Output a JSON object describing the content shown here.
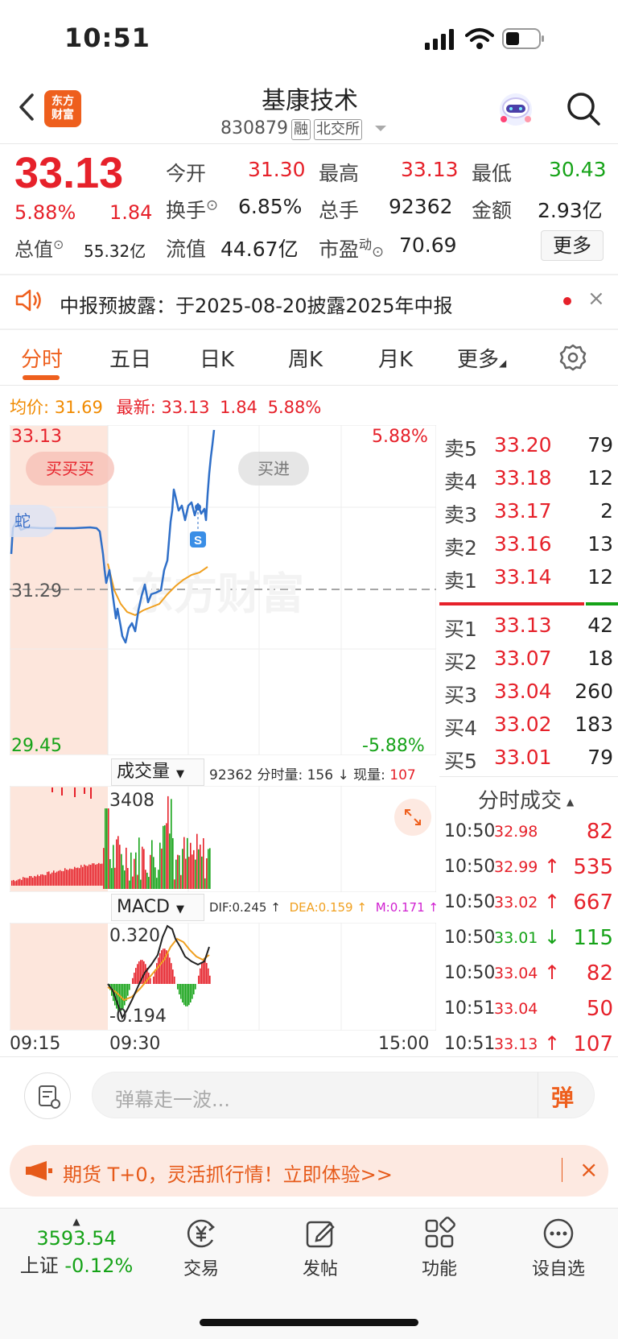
{
  "status_bar": {
    "time": "10:51"
  },
  "header": {
    "logo_line1": "东方",
    "logo_line2": "财富",
    "name": "基康技术",
    "code": "830879",
    "tag_margin": "融",
    "tag_exchange": "北交所"
  },
  "quote": {
    "price": "33.13",
    "change_pct": "5.88%",
    "change": "1.84",
    "total_value_label": "总值",
    "total_value": "55.32亿",
    "open_label": "今开",
    "open": "31.30",
    "high_label": "最高",
    "high": "33.13",
    "low_label": "最低",
    "low": "30.43",
    "turnover_label": "换手",
    "turnover": "6.85%",
    "volume_label": "总手",
    "volume": "92362",
    "amount_label": "金额",
    "amount": "2.93亿",
    "float_label": "流值",
    "float_value": "44.67亿",
    "pe_label": "市盈",
    "pe_sup": "动",
    "pe": "70.69",
    "more_label": "更多"
  },
  "notice": {
    "text": "中报预披露：于2025-08-20披露2025年中报",
    "close": "×"
  },
  "tabs": [
    "分时",
    "五日",
    "日K",
    "周K",
    "月K",
    "更多"
  ],
  "info_line": {
    "avg_label": "均价:",
    "avg": "31.69",
    "latest_label": "最新:",
    "latest": "33.13",
    "chg": "1.84",
    "pct": "5.88%"
  },
  "chart": {
    "top_price": "33.13",
    "top_pct": "5.88%",
    "base_price": "31.29",
    "bottom_price": "29.45",
    "bottom_pct": "-5.88%",
    "buy_pill": "买买买",
    "buy_in_pill": "买进",
    "flag_label": "蛇",
    "s_marker": "S",
    "watermark": "东方财富",
    "volume_selector": "成交量",
    "volume_info": "92362 分时量: 156 ↓ 现量:",
    "volume_now": "107",
    "volume_peak": "3408",
    "macd_selector": "MACD",
    "dif": "DIF:0.245 ↑",
    "dea": "DEA:0.159 ↑",
    "m": "M:0.171 ↑",
    "macd_top": "0.320",
    "macd_bottom": "-0.194",
    "time_start": "09:15",
    "time_mid": "09:30",
    "time_end": "15:00"
  },
  "chart_data": {
    "type": "line",
    "title": "",
    "ylim": [
      29.45,
      33.13
    ],
    "prev_close": 31.29,
    "series": [
      {
        "name": "均价",
        "color": "#f0a020"
      },
      {
        "color": "#2f6fc8"
      }
    ]
  },
  "order_book": {
    "asks": [
      {
        "label": "卖5",
        "price": "33.20",
        "vol": "79"
      },
      {
        "label": "卖4",
        "price": "33.18",
        "vol": "12"
      },
      {
        "label": "卖3",
        "price": "33.17",
        "vol": "2"
      },
      {
        "label": "卖2",
        "price": "33.16",
        "vol": "13"
      },
      {
        "label": "卖1",
        "price": "33.14",
        "vol": "12"
      }
    ],
    "bids": [
      {
        "label": "买1",
        "price": "33.13",
        "vol": "42"
      },
      {
        "label": "买2",
        "price": "33.07",
        "vol": "18"
      },
      {
        "label": "买3",
        "price": "33.04",
        "vol": "260"
      },
      {
        "label": "买4",
        "price": "33.02",
        "vol": "183"
      },
      {
        "label": "买5",
        "price": "33.01",
        "vol": "79"
      }
    ]
  },
  "trades": {
    "title": "分时成交",
    "rows": [
      {
        "time": "10:50",
        "price": "32.98",
        "arrow": "",
        "vol": "82",
        "color": "red"
      },
      {
        "time": "10:50",
        "price": "32.99",
        "arrow": "↑",
        "vol": "535",
        "color": "red"
      },
      {
        "time": "10:50",
        "price": "33.02",
        "arrow": "↑",
        "vol": "667",
        "color": "red"
      },
      {
        "time": "10:50",
        "price": "33.01",
        "arrow": "↓",
        "vol": "115",
        "color": "green"
      },
      {
        "time": "10:50",
        "price": "33.04",
        "arrow": "↑",
        "vol": "82",
        "color": "red"
      },
      {
        "time": "10:51",
        "price": "33.04",
        "arrow": "",
        "vol": "50",
        "color": "red"
      },
      {
        "time": "10:51",
        "price": "33.13",
        "arrow": "↑",
        "vol": "107",
        "color": "red"
      }
    ]
  },
  "comment": {
    "placeholder": "弹幕走一波...",
    "danmu": "弹"
  },
  "ad": {
    "text": "期货 T+0，灵活抓行情！立即体验>>",
    "close": "×"
  },
  "bottom_nav": {
    "index_value": "3593.54",
    "index_name": "上证",
    "index_pct": "-0.12%",
    "items": [
      "交易",
      "发帖",
      "功能",
      "设自选"
    ]
  }
}
